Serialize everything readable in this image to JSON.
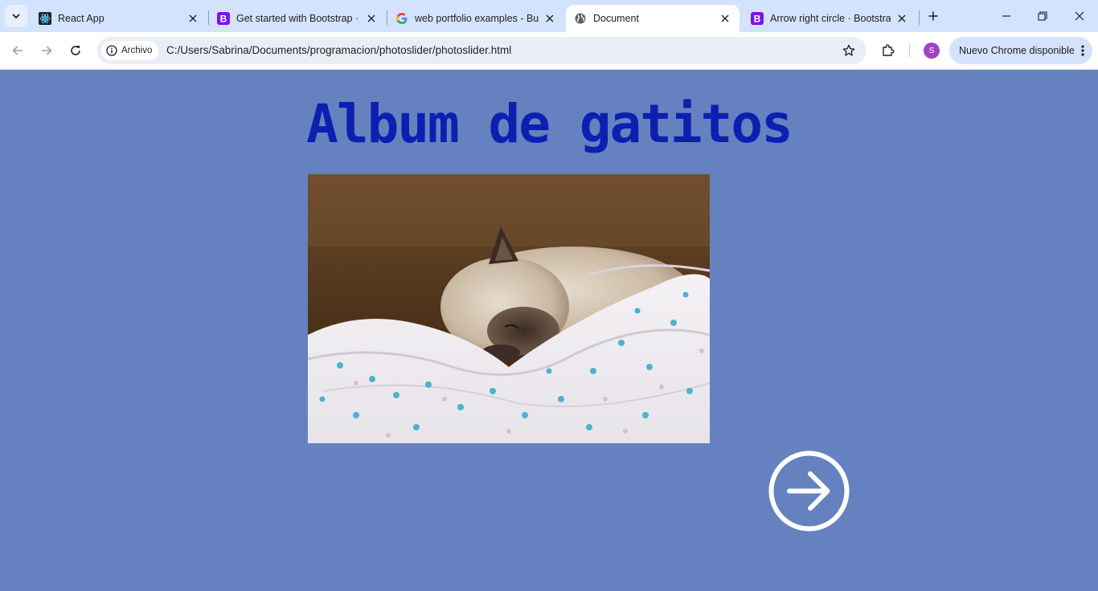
{
  "browser": {
    "tabs": [
      {
        "title": "React App",
        "favicon": "react-icon"
      },
      {
        "title": "Get started with Bootstrap · Bo",
        "favicon": "bootstrap-icon"
      },
      {
        "title": "web portfolio examples - Bu",
        "favicon": "google-icon"
      },
      {
        "title": "Document",
        "favicon": "globe-icon",
        "active": true
      },
      {
        "title": "Arrow right circle · Bootstrap",
        "favicon": "bootstrap-icon"
      }
    ],
    "security_chip": "Archivo",
    "url": "C:/Users/Sabrina/Documents/programacion/photoslider/photoslider.html",
    "avatar_letter": "S",
    "update_label": "Nuevo Chrome disponible",
    "colors": {
      "tabstrip": "#d3e3fd",
      "bootstrap": "#7b14e8",
      "avatar": "#a142c4"
    }
  },
  "page": {
    "heading": "Album de gatitos",
    "photo_subject": "sleeping-kitten-photo",
    "next_button_icon": "arrow-right-circle-icon",
    "colors": {
      "background": "#6681c0",
      "heading": "#0b1fb0",
      "arrow": "#ffffff"
    }
  }
}
